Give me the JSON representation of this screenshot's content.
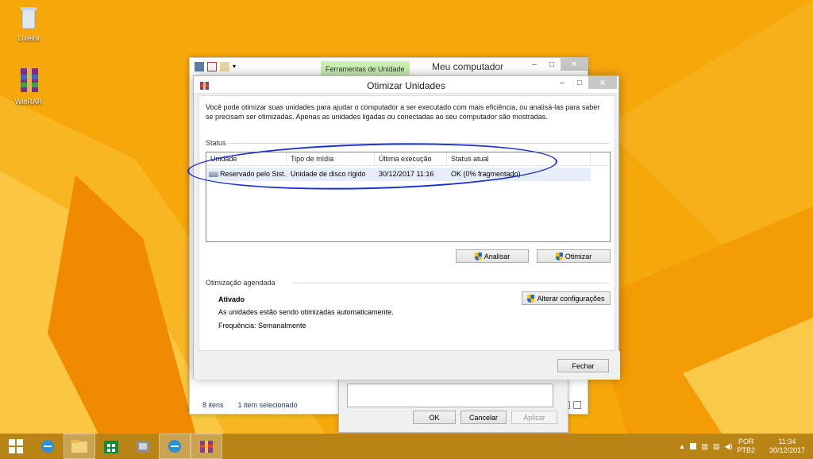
{
  "desktop": {
    "icons": [
      {
        "label": "Lixeira"
      },
      {
        "label": "WinRAR"
      }
    ]
  },
  "explorer": {
    "context_tab": "Ferramentas de Unidade",
    "title": "Meu computador",
    "status_items": "8 itens",
    "status_selected": "1 item selecionado"
  },
  "props_dialog": {
    "ok": "OK",
    "cancel": "Cancelar",
    "apply": "Aplicar"
  },
  "dialog": {
    "title": "Otimizar Unidades",
    "intro": "Você pode otimizar suas unidades para ajudar o computador a ser executado com mais eficiência, ou analisá-las para saber se precisam ser otimizadas. Apenas as unidades ligadas ou conectadas ao seu computador são mostradas.",
    "status_label": "Status",
    "columns": [
      "Unidade",
      "Tipo de mídia",
      "Última execução",
      "Status atual"
    ],
    "rows": [
      {
        "drive": "Reservado pelo Sist...",
        "media": "Unidade de disco rígido",
        "last_run": "30/12/2017 11:16",
        "status": "OK (0% fragmentado)"
      }
    ],
    "analyze_button": "Analisar",
    "optimize_button": "Otimizar",
    "scheduled_label": "Otimização agendada",
    "scheduled_state": "Ativado",
    "scheduled_desc": "As unidades estão sendo otimizadas automaticamente.",
    "frequency": "Frequência: Semanalmente",
    "change_settings_button": "Alterar configurações",
    "close_button": "Fechar"
  },
  "taskbar": {
    "lang1": "POR",
    "lang2": "PTB2",
    "time": "11:34",
    "date": "30/12/2017"
  },
  "colors": {
    "desktop": "#f5a70a",
    "taskbar": "#b88416",
    "annotation": "#1a2fd6"
  }
}
